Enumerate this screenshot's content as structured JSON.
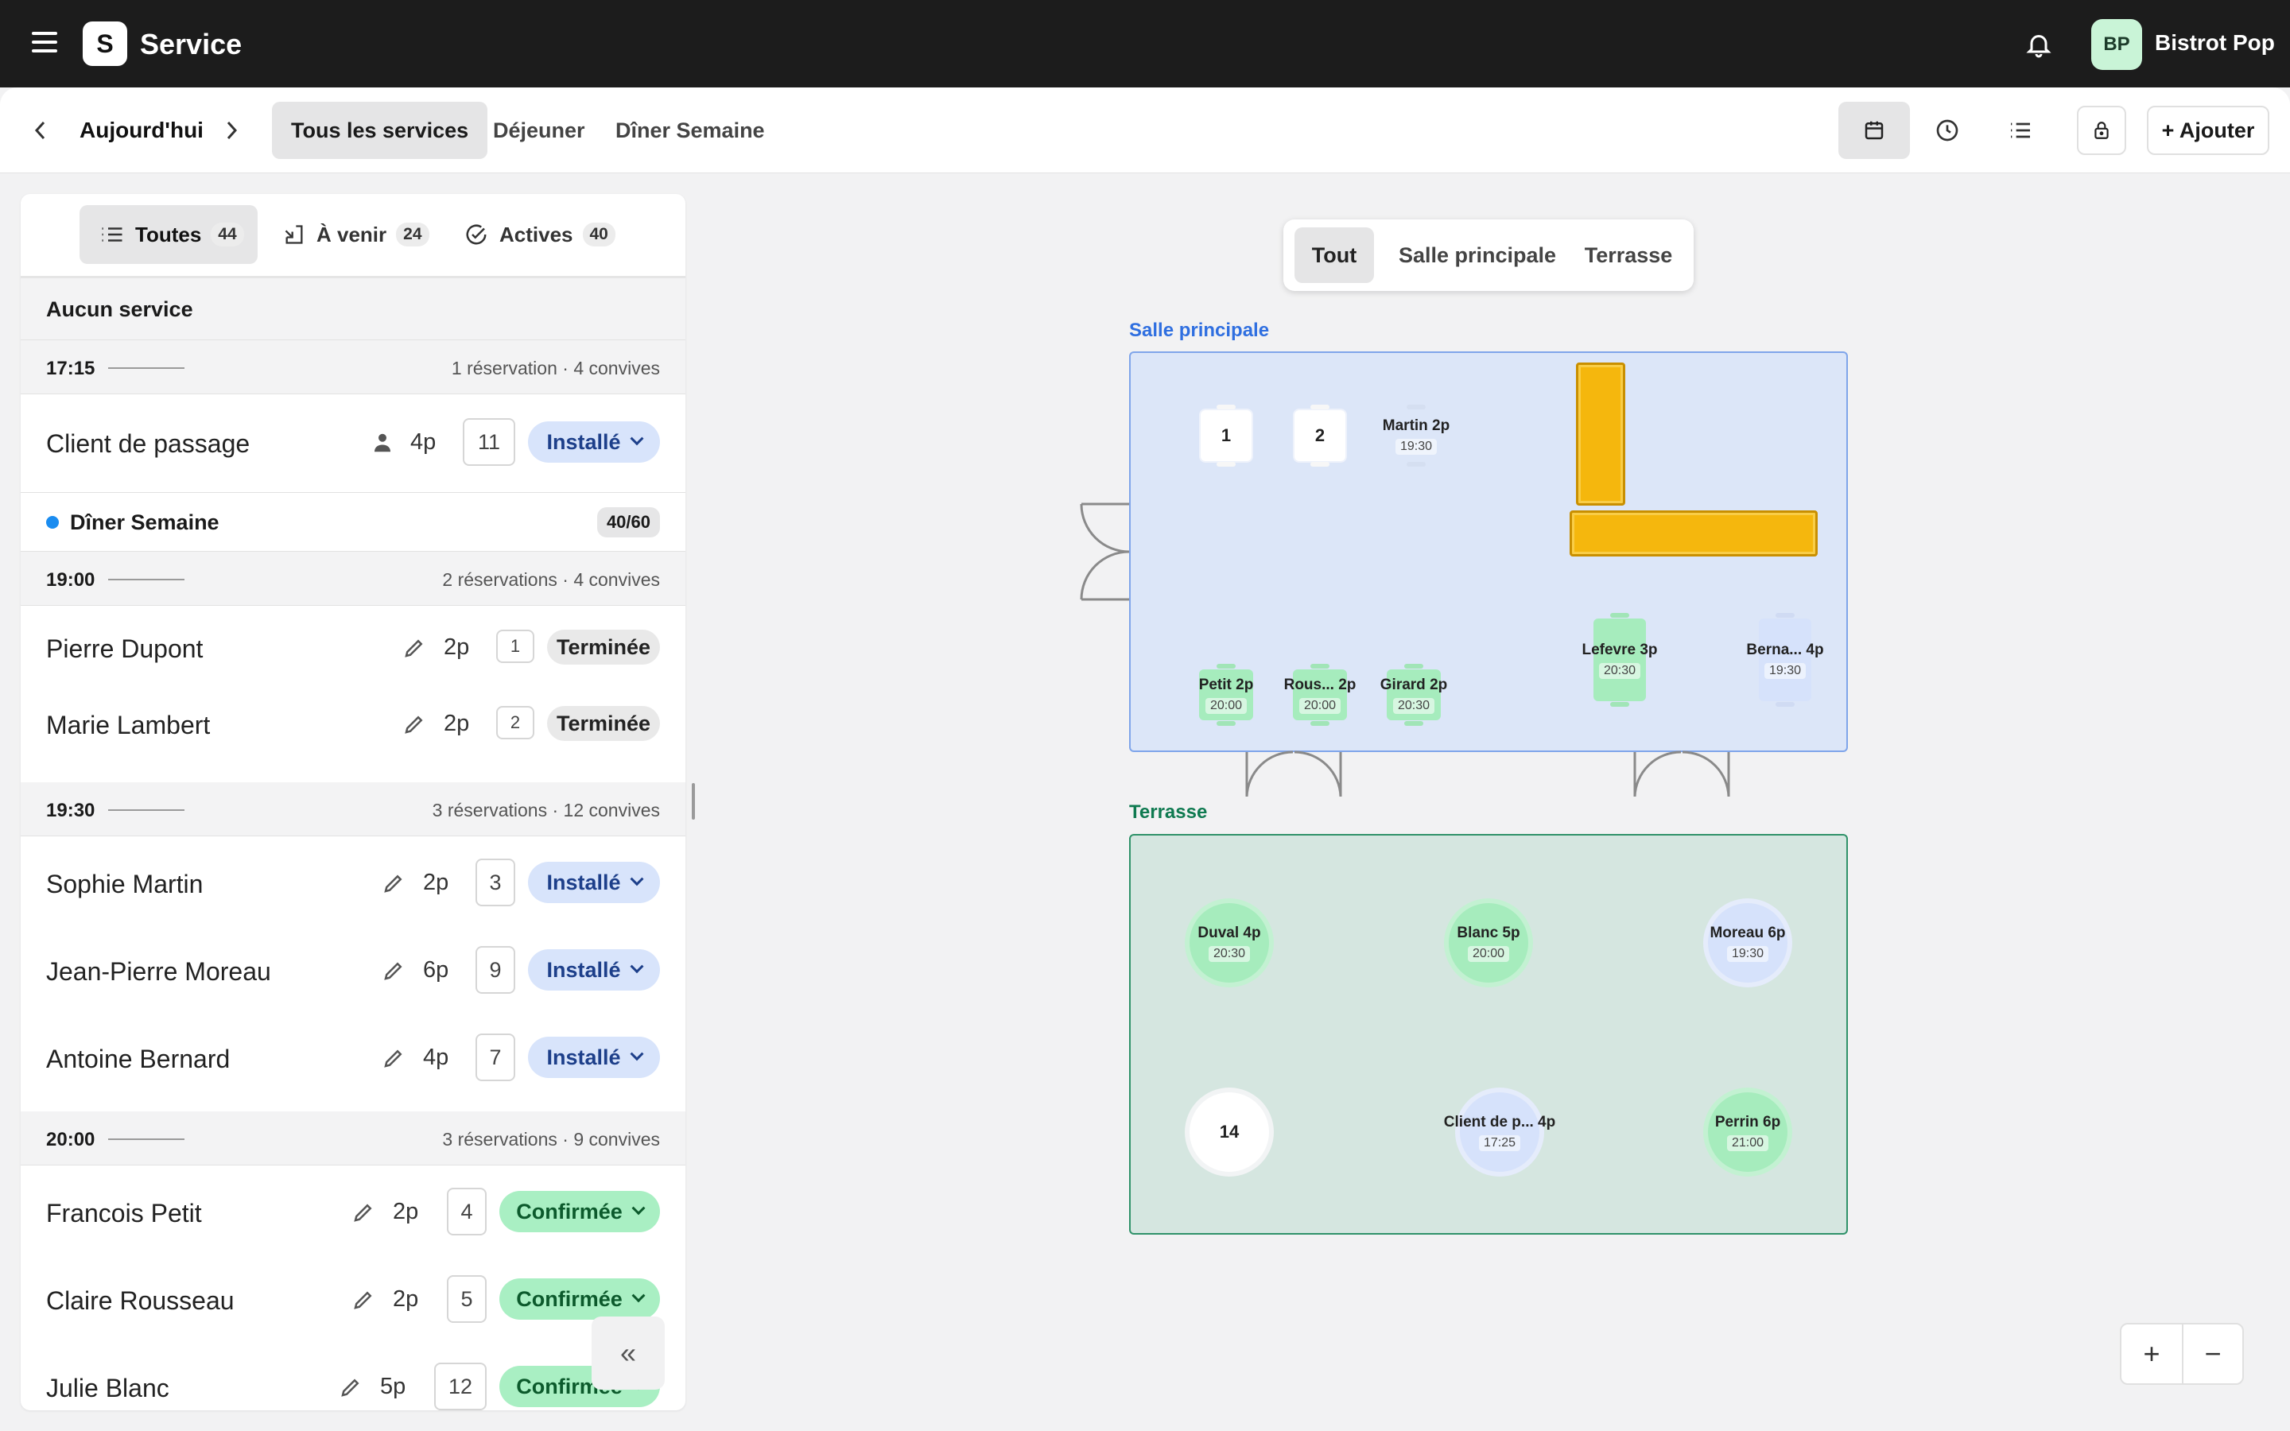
{
  "app": {
    "logo_letter": "S",
    "title": "Service",
    "restaurant_initials": "BP",
    "restaurant_name": "Bistrot Pop"
  },
  "subheader": {
    "date_label": "Aujourd'hui",
    "service_tabs": [
      {
        "label": "Tous les services",
        "active": true
      },
      {
        "label": "Déjeuner",
        "active": false
      },
      {
        "label": "Dîner Semaine",
        "active": false
      }
    ],
    "view_icons": [
      "calendar-icon",
      "clock-icon",
      "list-icon"
    ],
    "add_label": "+ Ajouter"
  },
  "filters": [
    {
      "label": "Toutes",
      "count": "44",
      "icon": "list-icon",
      "active": true
    },
    {
      "label": "À venir",
      "count": "24",
      "icon": "arrival-icon",
      "active": false
    },
    {
      "label": "Actives",
      "count": "40",
      "icon": "check-circle-icon",
      "active": false
    }
  ],
  "list": {
    "no_service_title": "Aucun service",
    "slot_1715": {
      "time": "17:15",
      "summary": "1 réservation · 4 convives"
    },
    "walkin": {
      "name": "Client de passage",
      "covers": "4p",
      "table": "11",
      "status": "Installé"
    },
    "diner_section": {
      "title": "Dîner Semaine",
      "ratio": "40/60",
      "accent": "#1a8cf0"
    },
    "slot_1900": {
      "time": "19:00",
      "summary": "2 réservations · 4 convives"
    },
    "slot_1930": {
      "time": "19:30",
      "summary": "3 réservations · 12 convives"
    },
    "slot_2000": {
      "time": "20:00",
      "summary": "3 réservations · 9 convives"
    },
    "reservations": [
      {
        "name": "Pierre Dupont",
        "covers": "2p",
        "table": "1",
        "status": "Terminée"
      },
      {
        "name": "Marie Lambert",
        "covers": "2p",
        "table": "2",
        "status": "Terminée"
      },
      {
        "name": "Sophie Martin",
        "covers": "2p",
        "table": "3",
        "status": "Installé"
      },
      {
        "name": "Jean-Pierre Moreau",
        "covers": "6p",
        "table": "9",
        "status": "Installé"
      },
      {
        "name": "Antoine Bernard",
        "covers": "4p",
        "table": "7",
        "status": "Installé"
      },
      {
        "name": "Francois Petit",
        "covers": "2p",
        "table": "4",
        "status": "Confirmée"
      },
      {
        "name": "Claire Rousseau",
        "covers": "2p",
        "table": "5",
        "status": "Confirmée"
      },
      {
        "name": "Julie Blanc",
        "covers": "5p",
        "table": "12",
        "status": "Confirmée"
      }
    ],
    "collapse_label": "«"
  },
  "floor": {
    "zone_tabs": [
      {
        "label": "Tout",
        "active": true
      },
      {
        "label": "Salle principale",
        "active": false
      },
      {
        "label": "Terrasse",
        "active": false
      }
    ],
    "main_room": {
      "label": "Salle principale",
      "color": "#2f6fe0",
      "tables": [
        {
          "id": "t1",
          "label": "1"
        },
        {
          "id": "t2",
          "label": "2"
        },
        {
          "id": "martin",
          "label": "Martin 2p",
          "time": "19:30"
        },
        {
          "id": "petit",
          "label": "Petit 2p",
          "time": "20:00"
        },
        {
          "id": "rous",
          "label": "Rous... 2p",
          "time": "20:00"
        },
        {
          "id": "girard",
          "label": "Girard 2p",
          "time": "20:30"
        },
        {
          "id": "lefevre",
          "label": "Lefevre 3p",
          "time": "20:30"
        },
        {
          "id": "berna",
          "label": "Berna... 4p",
          "time": "19:30"
        }
      ]
    },
    "terrace": {
      "label": "Terrasse",
      "color": "#0f7a50",
      "tables": [
        {
          "id": "duval",
          "label": "Duval 4p",
          "time": "20:30"
        },
        {
          "id": "blanc",
          "label": "Blanc 5p",
          "time": "20:00"
        },
        {
          "id": "moreau",
          "label": "Moreau 6p",
          "time": "19:30"
        },
        {
          "id": "t14",
          "label": "14"
        },
        {
          "id": "clientp",
          "label": "Client de p... 4p",
          "time": "17:25"
        },
        {
          "id": "perrin",
          "label": "Perrin 6p",
          "time": "21:00"
        }
      ]
    },
    "zoom_in": "+",
    "zoom_out": "−"
  }
}
